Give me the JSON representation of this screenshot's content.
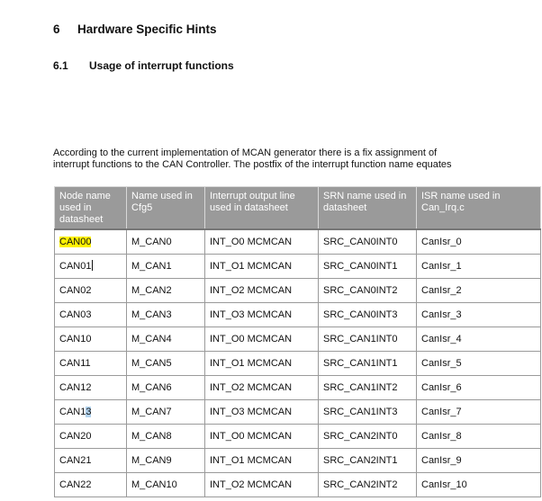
{
  "heading": {
    "number": "6",
    "title": "Hardware Specific Hints"
  },
  "subheading": {
    "number": "6.1",
    "title": "Usage of interrupt functions"
  },
  "paragraph": {
    "line1": "According to the current implementation of MCAN generator there is a fix assignment of",
    "line2": "interrupt functions to the CAN Controller. The postfix of the interrupt function name equates"
  },
  "table": {
    "headers": [
      "Node name used in datasheet",
      "Name used in Cfg5",
      "Interrupt output line used in datasheet",
      "SRN name used in datasheet",
      "ISR name used in Can_Irq.c"
    ],
    "rows": [
      {
        "node_main": "CAN00",
        "node_tail": "",
        "cfg5": "M_CAN0",
        "int_line": "INT_O0 MCMCAN",
        "srn": "SRC_CAN0INT0",
        "isr": "CanIsr_0"
      },
      {
        "node_main": "CAN01",
        "node_tail": "",
        "cfg5": "M_CAN1",
        "int_line": "INT_O1 MCMCAN",
        "srn": "SRC_CAN0INT1",
        "isr": "CanIsr_1"
      },
      {
        "node_main": "CAN02",
        "node_tail": "",
        "cfg5": "M_CAN2",
        "int_line": "INT_O2 MCMCAN",
        "srn": "SRC_CAN0INT2",
        "isr": "CanIsr_2"
      },
      {
        "node_main": "CAN03",
        "node_tail": "",
        "cfg5": "M_CAN3",
        "int_line": "INT_O3 MCMCAN",
        "srn": "SRC_CAN0INT3",
        "isr": "CanIsr_3"
      },
      {
        "node_main": "CAN10",
        "node_tail": "",
        "cfg5": "M_CAN4",
        "int_line": "INT_O0 MCMCAN",
        "srn": "SRC_CAN1INT0",
        "isr": "CanIsr_4"
      },
      {
        "node_main": "CAN11",
        "node_tail": "",
        "cfg5": "M_CAN5",
        "int_line": "INT_O1 MCMCAN",
        "srn": "SRC_CAN1INT1",
        "isr": "CanIsr_5"
      },
      {
        "node_main": "CAN12",
        "node_tail": "",
        "cfg5": "M_CAN6",
        "int_line": "INT_O2 MCMCAN",
        "srn": "SRC_CAN1INT2",
        "isr": "CanIsr_6"
      },
      {
        "node_main": "CAN1",
        "node_tail": "3",
        "cfg5": "M_CAN7",
        "int_line": "INT_O3 MCMCAN",
        "srn": "SRC_CAN1INT3",
        "isr": "CanIsr_7"
      },
      {
        "node_main": "CAN20",
        "node_tail": "",
        "cfg5": "M_CAN8",
        "int_line": "INT_O0 MCMCAN",
        "srn": "SRC_CAN2INT0",
        "isr": "CanIsr_8"
      },
      {
        "node_main": "CAN21",
        "node_tail": "",
        "cfg5": "M_CAN9",
        "int_line": "INT_O1 MCMCAN",
        "srn": "SRC_CAN2INT1",
        "isr": "CanIsr_9"
      },
      {
        "node_main": "CAN22",
        "node_tail": "",
        "cfg5": "M_CAN10",
        "int_line": "INT_O2 MCMCAN",
        "srn": "SRC_CAN2INT2",
        "isr": "CanIsr_10"
      }
    ]
  },
  "colors": {
    "header_bg": "#9a9a9a",
    "highlight_yellow": "#fff200",
    "selection_blue": "#b3d4f0"
  }
}
